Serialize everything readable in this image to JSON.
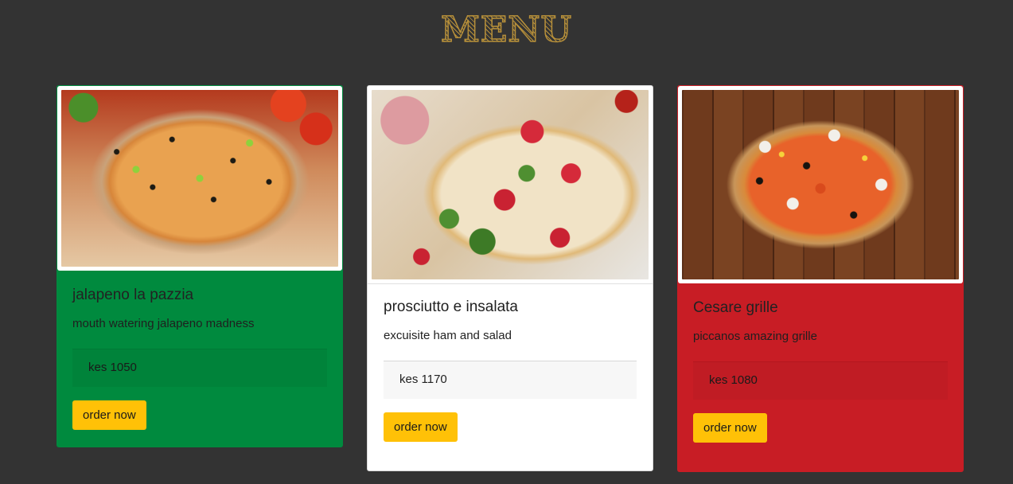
{
  "page": {
    "title": "MENU",
    "colors": {
      "background": "#333333",
      "title": "#b68f3a",
      "button": "#ffc107",
      "card_green": "#008a3e",
      "card_white": "#ffffff",
      "card_red": "#c81d25"
    }
  },
  "menu": {
    "items": [
      {
        "name": "jalapeno la pazzia",
        "description": "mouth watering jalapeno madness",
        "price": "kes 1050",
        "button": "order now",
        "image_alt": "pizza with jalapeno and olives"
      },
      {
        "name": "prosciutto e insalata",
        "description": "excuisite ham and salad",
        "price": "kes 1170",
        "button": "order now",
        "image_alt": "pizza with prosciutto, strawberries and rocket"
      },
      {
        "name": "Cesare grille",
        "description": "piccanos amazing grille",
        "price": "kes 1080",
        "button": "order now",
        "image_alt": "pizza with mushrooms and olives on wooden board"
      }
    ]
  }
}
